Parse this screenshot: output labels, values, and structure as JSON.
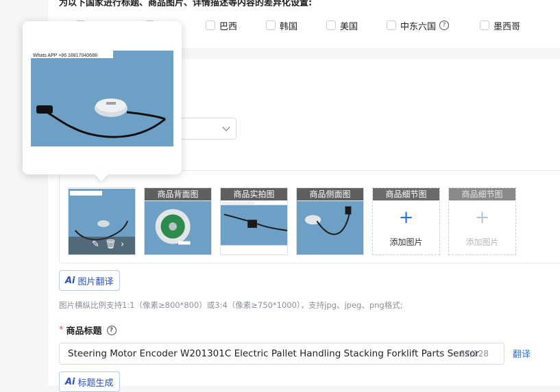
{
  "section": {
    "country_title": "为以下国家进行标题、商品图片、详情描述等内容的差异化设置:",
    "countries": [
      {
        "label": "巴西"
      },
      {
        "label": "韩国"
      },
      {
        "label": "美国"
      },
      {
        "label": "中东六国"
      },
      {
        "label": "墨西哥"
      }
    ],
    "help_glyph": "?"
  },
  "popover": {
    "watermark": "Whats APP +86 18817040688"
  },
  "images": {
    "thumbs": [
      {
        "caption": ""
      },
      {
        "caption": "商品背面图"
      },
      {
        "caption": "商品实拍图"
      },
      {
        "caption": "商品侧面图"
      },
      {
        "caption": "商品细节图",
        "add_label": "添加图片",
        "plus": "+"
      },
      {
        "caption": "商品细节图",
        "add_label": "添加图片",
        "plus": "+"
      }
    ],
    "translate_btn": {
      "ai": "Ai",
      "label": "图片翻译"
    },
    "hint": "图片横纵比例支持1:1（像素≥800*800）或3:4（像素≥750*1000），支持jpg、jpeg、png格式;"
  },
  "title_field": {
    "required_mark": "*",
    "label": "商品标题",
    "value": "Steering Motor Encoder W201301C Electric Pallet Handling Stacking Forklift Parts Sensor",
    "count": "87/128",
    "translate_link": "翻译",
    "gen_btn": {
      "ai": "Ai",
      "label": "标题生成"
    }
  },
  "colors": {
    "accent": "#2670e8",
    "required": "#e34d4d",
    "photo_bg": "#6e9fc4"
  }
}
